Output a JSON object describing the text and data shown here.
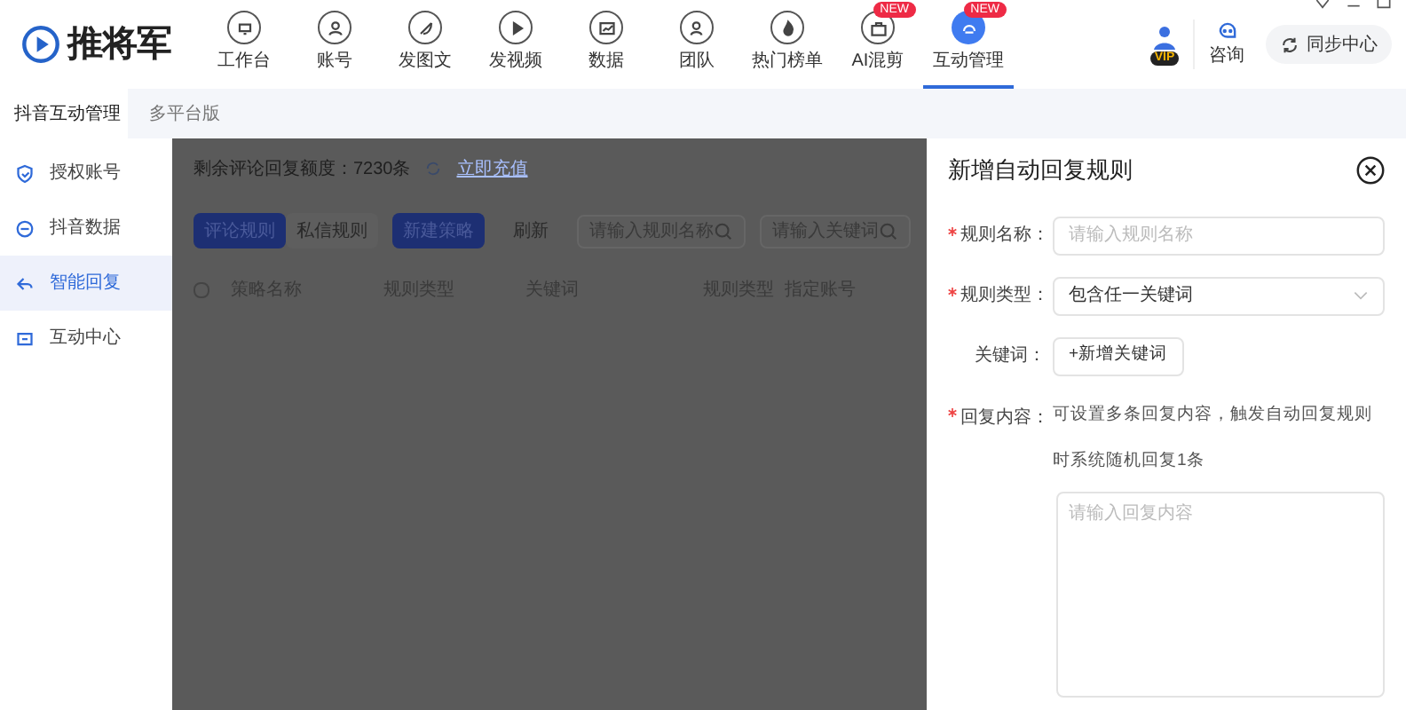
{
  "app": {
    "logo": "推将军"
  },
  "nav": [
    {
      "label": "工作台",
      "selected": false
    },
    {
      "label": "账号",
      "selected": false
    },
    {
      "label": "发图文",
      "selected": false
    },
    {
      "label": "发视频",
      "selected": false
    },
    {
      "label": "数据",
      "selected": false
    },
    {
      "label": "团队",
      "selected": false
    },
    {
      "label": "热门榜单",
      "selected": false
    },
    {
      "label": "AI混剪",
      "selected": false,
      "badge": "NEW"
    },
    {
      "label": "互动管理",
      "selected": true,
      "badge": "NEW"
    }
  ],
  "header_right": {
    "vip": "VIP",
    "consult": "咨询",
    "sync": "同步中心"
  },
  "tabs": [
    {
      "label": "抖音互动管理",
      "selected": true
    },
    {
      "label": "多平台版",
      "selected": false
    }
  ],
  "sidebar": [
    {
      "label": "授权账号",
      "selected": false
    },
    {
      "label": "抖音数据",
      "selected": false
    },
    {
      "label": "智能回复",
      "selected": true
    },
    {
      "label": "互动中心",
      "selected": false
    }
  ],
  "main": {
    "quota": "剩余评论回复额度：7230条",
    "recharge": "立即充值",
    "rule_tabs": [
      {
        "label": "评论规则",
        "selected": true
      },
      {
        "label": "私信规则",
        "selected": false
      }
    ],
    "new_button": "新建策略",
    "refresh": "刷新",
    "search_name": {
      "placeholder": "请输入规则名称"
    },
    "search_keyword": {
      "placeholder": "请输入关键词"
    },
    "select_all": {
      "checked": false
    },
    "columns": [
      "策略名称",
      "规则类型",
      "关键词",
      "规则类型",
      "指定账号"
    ]
  },
  "drawer": {
    "title": "新增自动回复规则",
    "name": {
      "label": "规则名称：",
      "required": true,
      "placeholder": "请输入规则名称"
    },
    "type": {
      "label": "规则类型：",
      "required": true,
      "value": "包含任一关键词"
    },
    "keyword": {
      "label": "关键词：",
      "required": false,
      "button": "+新增关键词"
    },
    "reply": {
      "label": "回复内容：",
      "required": true,
      "hint": "可设置多条回复内容，触发自动回复规则时系统随机回复1条",
      "placeholder": "请输入回复内容"
    }
  }
}
